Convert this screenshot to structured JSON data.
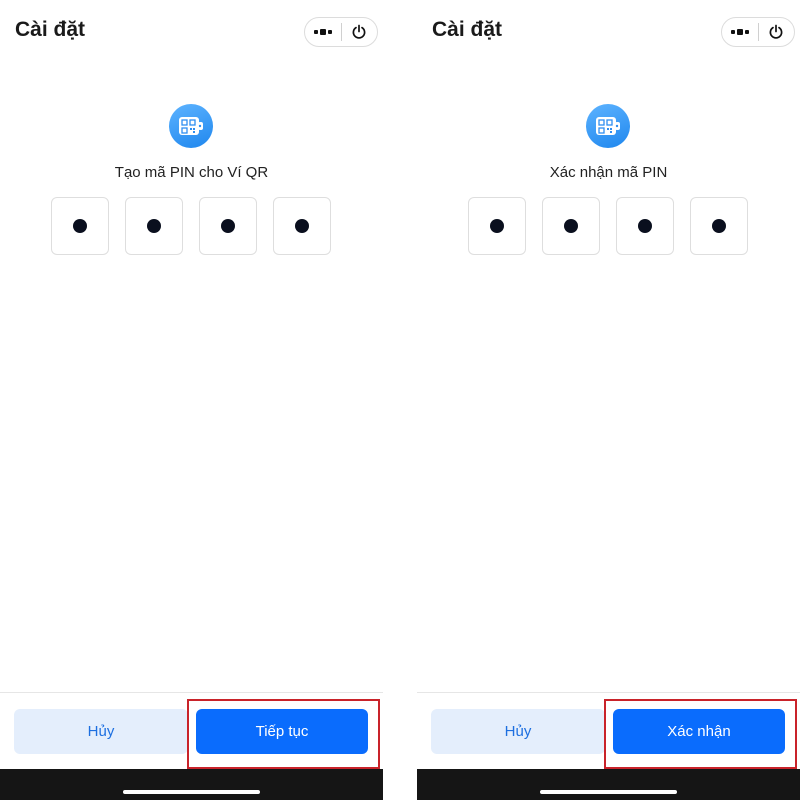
{
  "screens": [
    {
      "title": "Cài đặt",
      "prompt": "Tạo mã PIN cho Ví QR",
      "cancel_label": "Hủy",
      "primary_label": "Tiếp tục"
    },
    {
      "title": "Cài đặt",
      "prompt": "Xác nhận mã PIN",
      "cancel_label": "Hủy",
      "primary_label": "Xác nhận"
    }
  ],
  "pin": {
    "digits_total": 4,
    "digits_entered": 4
  },
  "icons": {
    "more": "more-dots-icon",
    "power": "power-icon",
    "app": "qr-wallet-icon"
  },
  "colors": {
    "primary": "#0a6cfd",
    "cancel_bg": "#e4eefc",
    "cancel_text": "#1d6fe0",
    "highlight": "#c9232a",
    "icon_gradient_top": "#5db3ff",
    "icon_gradient_bottom": "#1f87ee"
  }
}
